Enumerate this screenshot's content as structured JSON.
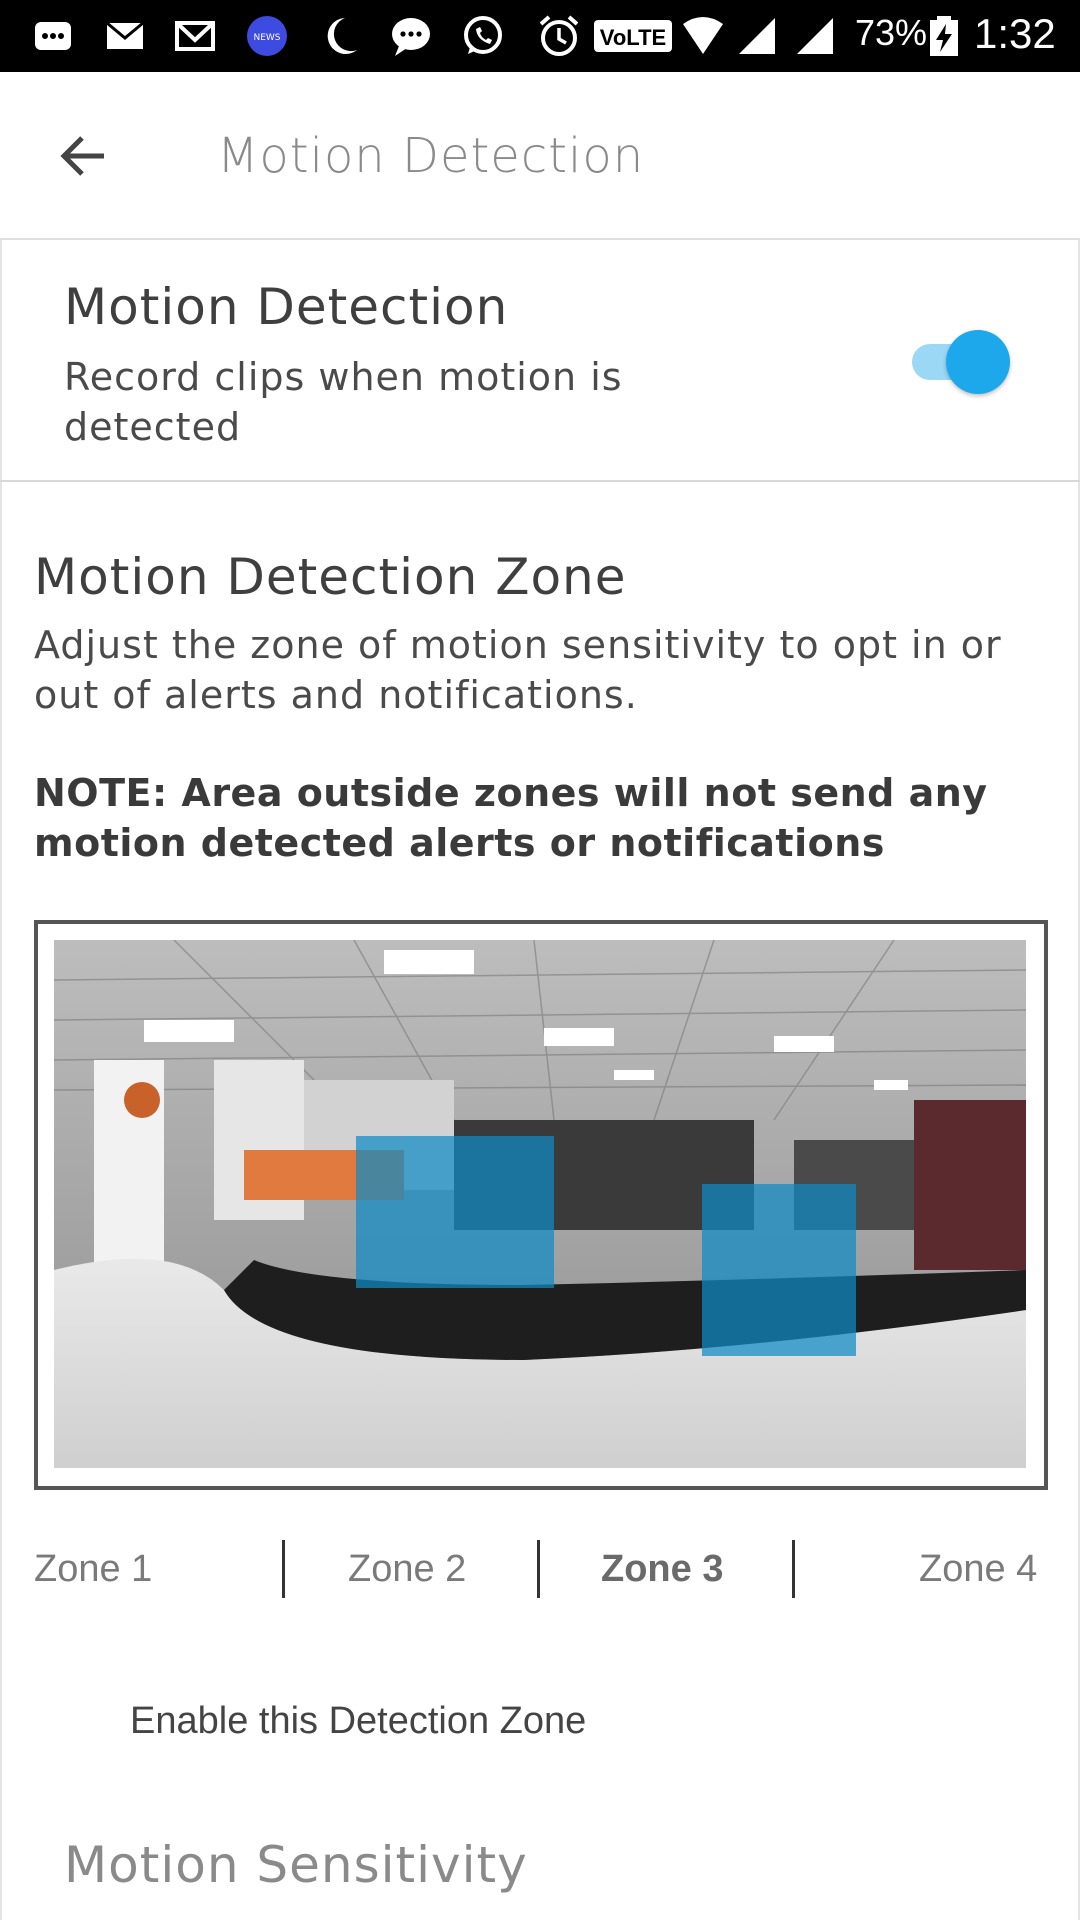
{
  "status_bar": {
    "icons": [
      "messages-icon",
      "email-icon",
      "gmail-icon",
      "news-icon",
      "moon-icon",
      "chat-icon",
      "whatsapp-icon",
      "alarm-icon",
      "volte-icon",
      "wifi-icon",
      "signal-icon",
      "signal-icon-2",
      "battery-charging-icon"
    ],
    "news_label": "NEWS",
    "volte_label": "VoLTE",
    "battery": "73%",
    "time": "1:32"
  },
  "app_bar": {
    "title": "Motion Detection",
    "back_icon": "arrow-back-icon"
  },
  "motion_detection": {
    "title": "Motion Detection",
    "description": "Record clips when motion is detected",
    "enabled": true,
    "toggle_color": "#1ea8ec"
  },
  "zone_section": {
    "title": "Motion Detection Zone",
    "description": "Adjust the zone of motion sensitivity to opt in or out of alerts and notifications.",
    "note": "NOTE: Area outside zones will not send any motion detected alerts or notifications",
    "zone_color": "#0e8bc4"
  },
  "zone_tabs": {
    "items": [
      "Zone 1",
      "Zone 2",
      "Zone 3",
      "Zone 4"
    ],
    "selected": "Zone 3"
  },
  "enable_zone_label": "Enable this Detection Zone",
  "sensitivity_title": "Motion Sensitivity"
}
